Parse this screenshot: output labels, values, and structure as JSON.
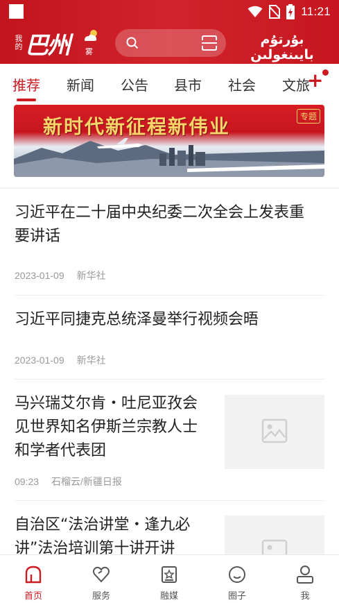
{
  "status": {
    "time": "11:21"
  },
  "brand": {
    "small_text": "我的",
    "big_text": "巴州",
    "weather_text": "雾",
    "uyghur_text": "بۇرتۇم بايىنغولىن"
  },
  "colors": {
    "accent": "#cc1a21",
    "header": "#c91a22"
  },
  "tabs": [
    "推荐",
    "新闻",
    "公告",
    "县市",
    "社会",
    "文旅"
  ],
  "banner": {
    "title": "新时代新征程新伟业",
    "badge": "专题"
  },
  "articles": [
    {
      "title_lines": [
        "习近平在二十届中央纪委二次全会上发表重",
        "要讲话"
      ],
      "date": "2023-01-09",
      "source": "新华社"
    },
    {
      "title_lines": [
        "习近平同捷克总统泽曼举行视频会晤"
      ],
      "date": "2023-01-09",
      "source": "新华社"
    },
    {
      "title_lines": [
        "马兴瑞艾尔肯・吐尼亚孜会",
        "见世界知名伊斯兰宗教人士",
        "和学者代表团"
      ],
      "date": "09:23",
      "source": "石榴云/新疆日报"
    },
    {
      "title_lines": [
        "自治区“法治讲堂・逢九必",
        "讲”法治培训第十讲开讲"
      ]
    }
  ],
  "bottom_nav": [
    "首页",
    "服务",
    "融媒",
    "圈子",
    "我"
  ]
}
